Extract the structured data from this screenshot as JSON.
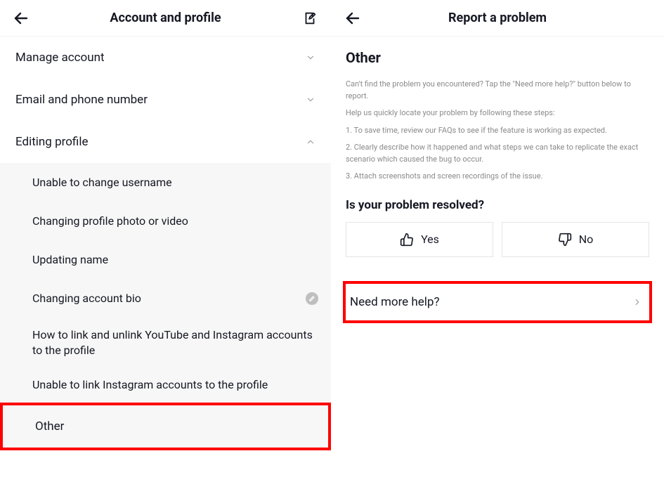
{
  "left": {
    "title": "Account and profile",
    "sections": [
      {
        "label": "Manage account",
        "expanded": false
      },
      {
        "label": "Email and phone number",
        "expanded": false
      },
      {
        "label": "Editing profile",
        "expanded": true
      }
    ],
    "editing_profile_items": [
      "Unable to change username",
      "Changing profile photo or video",
      "Updating name",
      "Changing account bio",
      "How to link and unlink YouTube and Instagram accounts to the profile",
      "Unable to link Instagram accounts to the profile",
      "Other"
    ]
  },
  "right": {
    "title": "Report a problem",
    "heading": "Other",
    "intro": "Can't find the problem you encountered? Tap the \"Need more help?\" button below to report.",
    "steps_intro": "Help us quickly locate your problem by following these steps:",
    "step1": "1. To save time, review our FAQs to see if the feature is working as expected.",
    "step2": "2. Clearly describe how it happened and what steps we can take to replicate the exact scenario which caused the bug to occur.",
    "step3": "3. Attach screenshots and screen recordings of the issue.",
    "question": "Is your problem resolved?",
    "yes": "Yes",
    "no": "No",
    "need_more": "Need more help?"
  }
}
